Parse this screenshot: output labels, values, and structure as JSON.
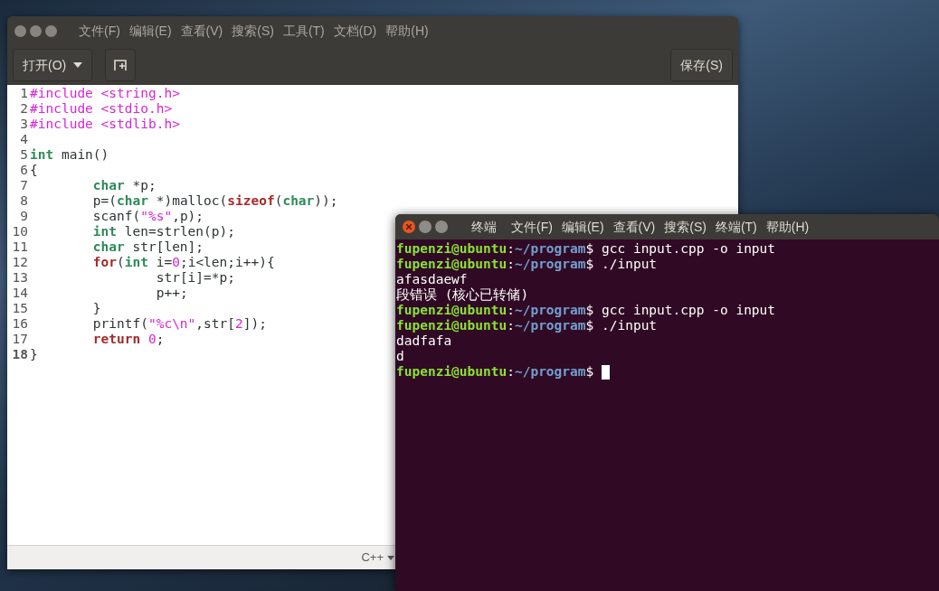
{
  "editor": {
    "menu": [
      "文件(F)",
      "编辑(E)",
      "查看(V)",
      "搜索(S)",
      "工具(T)",
      "文档(D)",
      "帮助(H)"
    ],
    "open_button": "打开(O)",
    "save_button": "保存(S)",
    "lines": [
      {
        "number": "1",
        "current": false,
        "tokens": [
          {
            "kind": "pp",
            "text": "#include <string.h>"
          }
        ]
      },
      {
        "number": "2",
        "current": false,
        "tokens": [
          {
            "kind": "pp",
            "text": "#include <stdio.h>"
          }
        ]
      },
      {
        "number": "3",
        "current": false,
        "tokens": [
          {
            "kind": "pp",
            "text": "#include <stdlib.h>"
          }
        ]
      },
      {
        "number": "4",
        "current": false
      },
      {
        "number": "5",
        "current": false,
        "tokens": [
          {
            "kind": "type",
            "text": "int"
          },
          {
            "kind": "plain",
            "text": " main()"
          }
        ]
      },
      {
        "number": "6",
        "current": false,
        "tokens": [
          {
            "kind": "plain",
            "text": "{"
          }
        ]
      },
      {
        "number": "7",
        "current": false,
        "tokens": [
          {
            "kind": "type",
            "text": "\tchar"
          },
          {
            "kind": "plain",
            "text": " *p;"
          }
        ]
      },
      {
        "number": "8",
        "current": false,
        "tokens": [
          {
            "kind": "plain",
            "text": "\tp=("
          },
          {
            "kind": "type",
            "text": "char"
          },
          {
            "kind": "plain",
            "text": " *)malloc("
          },
          {
            "kind": "kw",
            "text": "sizeof"
          },
          {
            "kind": "plain",
            "text": "("
          },
          {
            "kind": "type",
            "text": "char"
          },
          {
            "kind": "plain",
            "text": "));"
          }
        ]
      },
      {
        "number": "9",
        "current": false,
        "tokens": [
          {
            "kind": "plain",
            "text": "\tscanf("
          },
          {
            "kind": "str",
            "text": "\"%s\""
          },
          {
            "kind": "plain",
            "text": ",p);"
          }
        ]
      },
      {
        "number": "10",
        "current": false,
        "tokens": [
          {
            "kind": "type",
            "text": "\tint"
          },
          {
            "kind": "plain",
            "text": " len=strlen(p);"
          }
        ]
      },
      {
        "number": "11",
        "current": false,
        "tokens": [
          {
            "kind": "type",
            "text": "\tchar"
          },
          {
            "kind": "plain",
            "text": " str[len];"
          }
        ]
      },
      {
        "number": "12",
        "current": false,
        "tokens": [
          {
            "kind": "kw",
            "text": "\tfor"
          },
          {
            "kind": "plain",
            "text": "("
          },
          {
            "kind": "type",
            "text": "int"
          },
          {
            "kind": "plain",
            "text": " i="
          },
          {
            "kind": "num",
            "text": "0"
          },
          {
            "kind": "plain",
            "text": ";i<len;i++){"
          }
        ]
      },
      {
        "number": "13",
        "current": false,
        "tokens": [
          {
            "kind": "plain",
            "text": "\t\tstr[i]=*p;"
          }
        ]
      },
      {
        "number": "14",
        "current": false,
        "tokens": [
          {
            "kind": "plain",
            "text": "\t\tp++;"
          }
        ]
      },
      {
        "number": "15",
        "current": false,
        "tokens": [
          {
            "kind": "plain",
            "text": "\t}"
          }
        ]
      },
      {
        "number": "16",
        "current": false,
        "tokens": [
          {
            "kind": "plain",
            "text": "\tprintf("
          },
          {
            "kind": "str",
            "text": "\"%c\\n\""
          },
          {
            "kind": "plain",
            "text": ",str["
          },
          {
            "kind": "num",
            "text": "2"
          },
          {
            "kind": "plain",
            "text": "]);"
          }
        ]
      },
      {
        "number": "17",
        "current": false,
        "tokens": [
          {
            "kind": "kw",
            "text": "\treturn"
          },
          {
            "kind": "num",
            "text": " 0"
          },
          {
            "kind": "plain",
            "text": ";"
          }
        ]
      },
      {
        "number": "18",
        "current": true,
        "tokens": [
          {
            "kind": "plain",
            "text": "}"
          }
        ]
      }
    ],
    "language": "C++"
  },
  "terminal": {
    "title": "终端",
    "menu": [
      "文件(F)",
      "编辑(E)",
      "查看(V)",
      "搜索(S)",
      "终端(T)",
      "帮助(H)"
    ],
    "lines": [
      {
        "kind": "prompt",
        "user": "fupenzi@ubuntu",
        "separator": ":",
        "path": "~/program",
        "symbol": "$",
        "command": "gcc input.cpp -o input"
      },
      {
        "kind": "prompt",
        "user": "fupenzi@ubuntu",
        "separator": ":",
        "path": "~/program",
        "symbol": "$",
        "command": "./input"
      },
      {
        "kind": "output",
        "text": "afasdaewf"
      },
      {
        "kind": "output",
        "text": "段错误 (核心已转储)"
      },
      {
        "kind": "prompt",
        "user": "fupenzi@ubuntu",
        "separator": ":",
        "path": "~/program",
        "symbol": "$",
        "command": "gcc input.cpp -o input"
      },
      {
        "kind": "prompt",
        "user": "fupenzi@ubuntu",
        "separator": ":",
        "path": "~/program",
        "symbol": "$",
        "command": "./input"
      },
      {
        "kind": "output",
        "text": "dadfafa"
      },
      {
        "kind": "output",
        "text": "d"
      },
      {
        "kind": "prompt",
        "user": "fupenzi@ubuntu",
        "separator": ":",
        "path": "~/program",
        "symbol": "$",
        "cursor": true
      }
    ]
  }
}
